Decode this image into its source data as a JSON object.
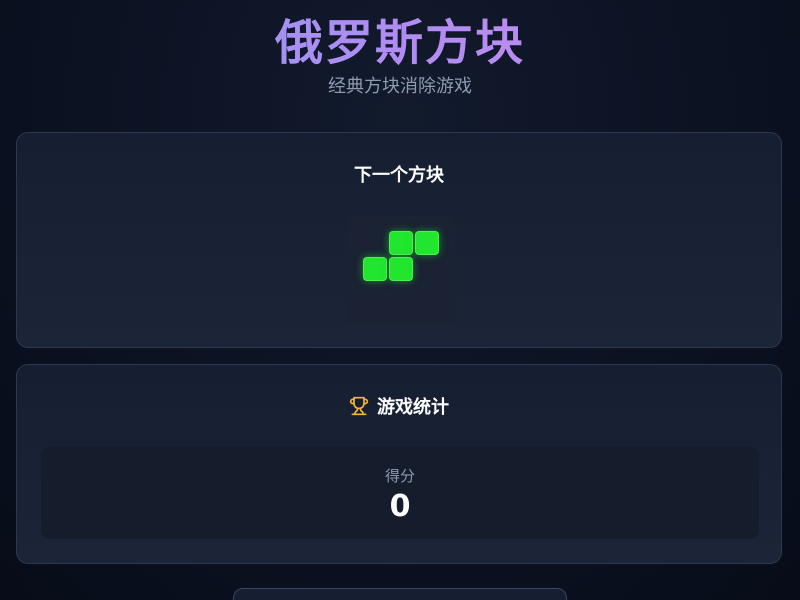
{
  "header": {
    "title": "俄罗斯方块",
    "subtitle": "经典方块消除游戏"
  },
  "next_piece": {
    "heading": "下一个方块",
    "piece": "S",
    "color": "#22e52e",
    "cells": [
      [
        0,
        1
      ],
      [
        0,
        2
      ],
      [
        1,
        0
      ],
      [
        1,
        1
      ]
    ]
  },
  "stats": {
    "heading": "游戏统计",
    "heading_icon": "trophy-icon",
    "score_label": "得分",
    "score_value": "0"
  },
  "colors": {
    "title_gradient_start": "#8f9cf5",
    "title_gradient_end": "#d08af0",
    "background": "#0b1222",
    "card_border": "#2c3850",
    "trophy": "#f5b731"
  }
}
